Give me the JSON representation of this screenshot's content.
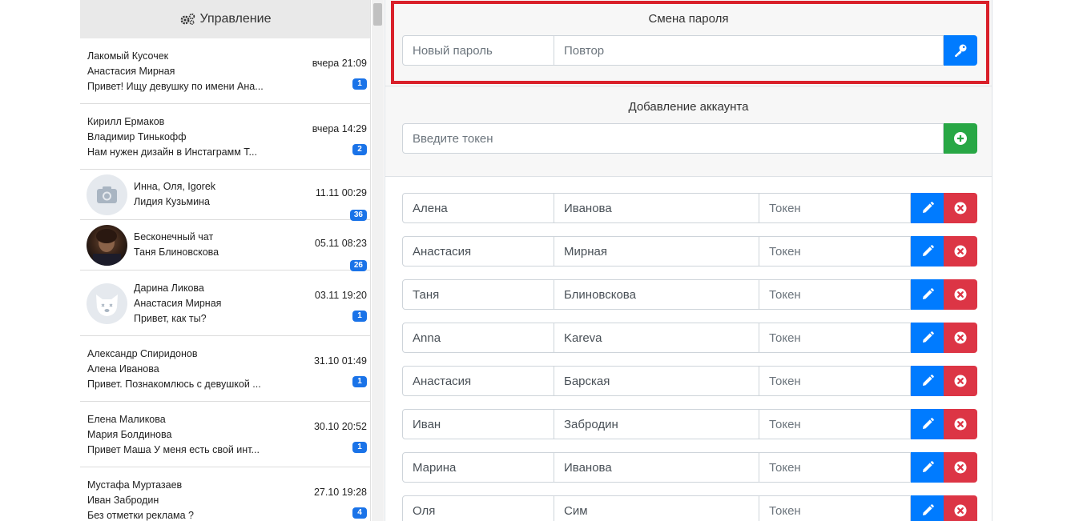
{
  "sidebar": {
    "header_label": "Управление",
    "chats": [
      {
        "line1": "Лакомый Кусочек",
        "line2": "Анастасия Мирная",
        "line3": "Привет! Ищу девушку по имени Ана...",
        "time": "вчера 21:09",
        "badge": "1",
        "avatar": ""
      },
      {
        "line1": "Кирилл Ермаков",
        "line2": "Владимир Тинькофф",
        "line3": "Нам нужен дизайн в Инстаграмм Т...",
        "time": "вчера 14:29",
        "badge": "2",
        "avatar": ""
      },
      {
        "line1": "Инна, Оля, Igorek",
        "line2": "Лидия Кузьмина",
        "line3": "",
        "time": "11.11 00:29",
        "badge": "36",
        "avatar": "camera-placeholder"
      },
      {
        "line1": "Бесконечный чат",
        "line2": "Таня Блиновскова",
        "line3": "",
        "time": "05.11 08:23",
        "badge": "26",
        "avatar": "photo"
      },
      {
        "line1": "Дарина Ликова",
        "line2": "Анастасия Мирная",
        "line3": "Привет, как ты?",
        "time": "03.11 19:20",
        "badge": "1",
        "avatar": "deactivated-dog"
      },
      {
        "line1": "Александр Спиридонов",
        "line2": "Алена Иванова",
        "line3": "Привет. Познакомлюсь с девушкой ...",
        "time": "31.10 01:49",
        "badge": "1",
        "avatar": ""
      },
      {
        "line1": "Елена Маликова",
        "line2": "Мария Болдинова",
        "line3": "Привет Маша У меня есть свой инт...",
        "time": "30.10 20:52",
        "badge": "1",
        "avatar": ""
      },
      {
        "line1": "Мустафа Муртазаев",
        "line2": "Иван Забродин",
        "line3": "Без отметки реклама ?",
        "time": "27.10 19:28",
        "badge": "4",
        "avatar": ""
      }
    ]
  },
  "password": {
    "title": "Смена пароля",
    "new_placeholder": "Новый пароль",
    "repeat_placeholder": "Повтор"
  },
  "add_account": {
    "title": "Добавление аккаунта",
    "token_placeholder": "Введите токен"
  },
  "accounts": [
    {
      "first": "Алена",
      "last": "Иванова",
      "token": "Токен"
    },
    {
      "first": "Анастасия",
      "last": "Мирная",
      "token": "Токен"
    },
    {
      "first": "Таня",
      "last": "Блиновскова",
      "token": "Токен"
    },
    {
      "first": "Anna",
      "last": "Kareva",
      "token": "Токен"
    },
    {
      "first": "Анастасия",
      "last": "Барская",
      "token": "Токен"
    },
    {
      "first": "Иван",
      "last": "Забродин",
      "token": "Токен"
    },
    {
      "first": "Марина",
      "last": "Иванова",
      "token": "Токен"
    },
    {
      "first": "Оля",
      "last": "Сим",
      "token": "Токен"
    }
  ],
  "colors": {
    "primary": "#007bff",
    "success": "#28a745",
    "danger": "#dc3545",
    "badge": "#1a73e8",
    "highlight": "#d9202a"
  },
  "icons": {
    "header": "gears-icon",
    "password_button": "key-icon",
    "add_button": "plus-circle-icon",
    "edit_button": "pencil-icon",
    "delete_button": "times-circle-icon"
  }
}
